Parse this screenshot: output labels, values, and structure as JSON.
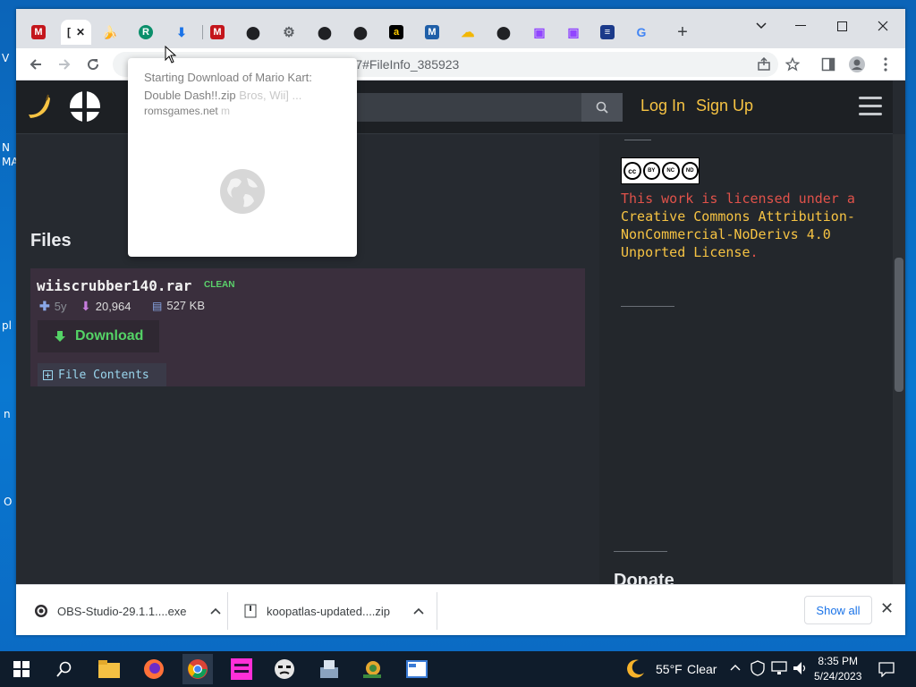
{
  "desktop": {
    "labels": [
      "V",
      "N",
      "MA",
      "pl",
      "n",
      "O"
    ]
  },
  "browser": {
    "tabs": [
      {
        "name": "tab-m-1",
        "glyph": "M",
        "color": "#c4161c"
      },
      {
        "name": "tab-active",
        "glyph": "[",
        "active": true
      },
      {
        "name": "tab-banana",
        "glyph": "🍌"
      },
      {
        "name": "tab-r",
        "glyph": "R",
        "color": "#0b8f6b"
      },
      {
        "name": "tab-download",
        "glyph": "⬇",
        "color": "#1a73e8"
      },
      {
        "name": "tab-m-2",
        "glyph": "M",
        "color": "#c4161c"
      },
      {
        "name": "tab-github-1",
        "glyph": "⬤"
      },
      {
        "name": "tab-gear",
        "glyph": "⚙"
      },
      {
        "name": "tab-github-2",
        "glyph": "⬤"
      },
      {
        "name": "tab-github-3",
        "glyph": "⬤"
      },
      {
        "name": "tab-a",
        "glyph": "a"
      },
      {
        "name": "tab-m-blue",
        "glyph": "M"
      },
      {
        "name": "tab-cloud",
        "glyph": "☁"
      },
      {
        "name": "tab-github-4",
        "glyph": "⬤"
      },
      {
        "name": "tab-twitch-1",
        "glyph": "▣"
      },
      {
        "name": "tab-twitch-2",
        "glyph": "▣"
      },
      {
        "name": "tab-blue",
        "glyph": "≡"
      },
      {
        "name": "tab-google",
        "glyph": "G"
      }
    ],
    "active_tab_close": "✕",
    "new_tab": "+",
    "url_visible": "5467#FileInfo_385923"
  },
  "popup": {
    "title": "Starting Download of Mario Kart: Double Dash!!.zip",
    "ghost_text": "Bros, Wii] ...",
    "site": "romsgames.net",
    "ghost_site": "m"
  },
  "site": {
    "search_placeholder": ".",
    "login": "Log In",
    "signup": "Sign Up",
    "files_title": "Files",
    "file": {
      "name": "wiiscrubber140.rar",
      "badge": "CLEAN",
      "age": "5y",
      "downloads": "20,964",
      "size": "527 KB",
      "download_label": "Download",
      "contents_label": "File Contents"
    },
    "license": {
      "cc_labels": [
        "BY",
        "NC",
        "ND"
      ],
      "prefix": "This work is licensed under a",
      "link": "Creative Commons Attribution-NonCommercial-NoDerivs 4.0 Unported License",
      "suffix": "."
    },
    "donate": "Donate"
  },
  "downloads_bar": {
    "items": [
      {
        "label": "OBS-Studio-29.1.1....exe"
      },
      {
        "label": "koopatlas-updated....zip"
      }
    ],
    "show_all": "Show all"
  },
  "taskbar": {
    "weather_temp": "55°F",
    "weather_desc": "Clear",
    "time": "8:35 PM",
    "date": "5/24/2023"
  },
  "colors": {
    "accent_yellow": "#f6c343",
    "license_red": "#e0524a",
    "download_green": "#54d366",
    "page_bg": "#262a30"
  }
}
